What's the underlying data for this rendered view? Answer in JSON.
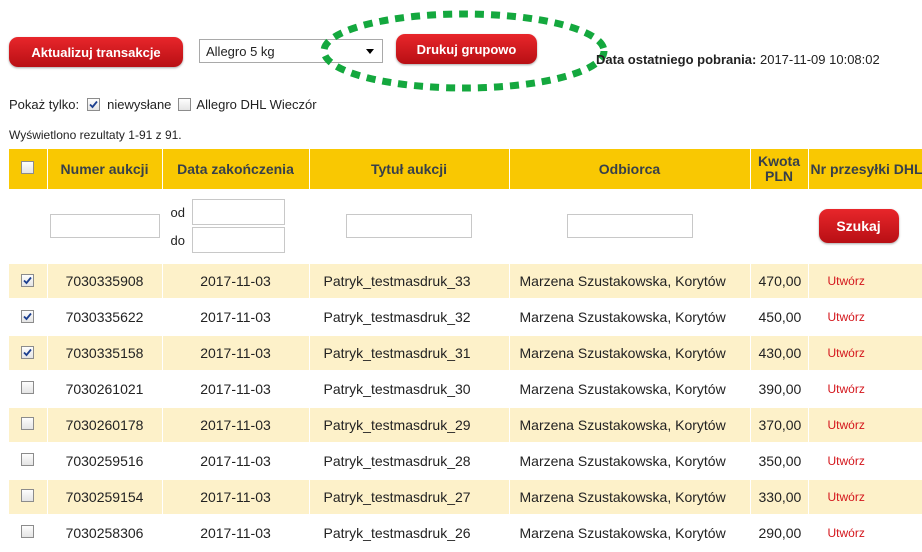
{
  "toolbar": {
    "update_label": "Aktualizuj transakcje",
    "package_select": "Allegro 5 kg",
    "print_label": "Drukuj grupowo",
    "last_download_label": "Data ostatniego pobrania:",
    "last_download_value": "2017-11-09 10:08:02"
  },
  "filters": {
    "show_only_label": "Pokaż tylko:",
    "unsent_label": "niewysłane",
    "unsent_checked": true,
    "dhl_evening_label": "Allegro DHL Wieczór",
    "dhl_evening_checked": false
  },
  "results_info": "Wyświetlono rezultaty 1-91 z 91.",
  "table": {
    "headers": {
      "auction_number": "Numer aukcji",
      "end_date": "Data zakończenia",
      "title": "Tytuł aukcji",
      "recipient": "Odbiorca",
      "amount": "Kwota PLN",
      "dhl_number": "Nr przesyłki DHL"
    },
    "from_label": "od",
    "to_label": "do",
    "search_label": "Szukaj",
    "rows": [
      {
        "checked": true,
        "auction": "7030335908",
        "date": "2017-11-03",
        "title": "Patryk_testmasdruk_33",
        "recipient": "Marzena Szustakowska, Korytów",
        "amount": "470,00",
        "dhl": "Utwórz"
      },
      {
        "checked": true,
        "auction": "7030335622",
        "date": "2017-11-03",
        "title": "Patryk_testmasdruk_32",
        "recipient": "Marzena Szustakowska, Korytów",
        "amount": "450,00",
        "dhl": "Utwórz"
      },
      {
        "checked": true,
        "auction": "7030335158",
        "date": "2017-11-03",
        "title": "Patryk_testmasdruk_31",
        "recipient": "Marzena Szustakowska, Korytów",
        "amount": "430,00",
        "dhl": "Utwórz"
      },
      {
        "checked": false,
        "auction": "7030261021",
        "date": "2017-11-03",
        "title": "Patryk_testmasdruk_30",
        "recipient": "Marzena Szustakowska, Korytów",
        "amount": "390,00",
        "dhl": "Utwórz"
      },
      {
        "checked": false,
        "auction": "7030260178",
        "date": "2017-11-03",
        "title": "Patryk_testmasdruk_29",
        "recipient": "Marzena Szustakowska, Korytów",
        "amount": "370,00",
        "dhl": "Utwórz"
      },
      {
        "checked": false,
        "auction": "7030259516",
        "date": "2017-11-03",
        "title": "Patryk_testmasdruk_28",
        "recipient": "Marzena Szustakowska, Korytów",
        "amount": "350,00",
        "dhl": "Utwórz"
      },
      {
        "checked": false,
        "auction": "7030259154",
        "date": "2017-11-03",
        "title": "Patryk_testmasdruk_27",
        "recipient": "Marzena Szustakowska, Korytów",
        "amount": "330,00",
        "dhl": "Utwórz"
      },
      {
        "checked": false,
        "auction": "7030258306",
        "date": "2017-11-03",
        "title": "Patryk_testmasdruk_26",
        "recipient": "Marzena Szustakowska, Korytów",
        "amount": "290,00",
        "dhl": "Utwórz"
      }
    ]
  },
  "colors": {
    "button_red": "#d0171c",
    "header_yellow": "#f9c802",
    "row_stripe": "#fdf1c9",
    "link_red": "#d4161c",
    "highlight_green": "#14a83e"
  },
  "icons": {
    "check": "check-icon",
    "dropdown": "chevron-down-icon"
  }
}
